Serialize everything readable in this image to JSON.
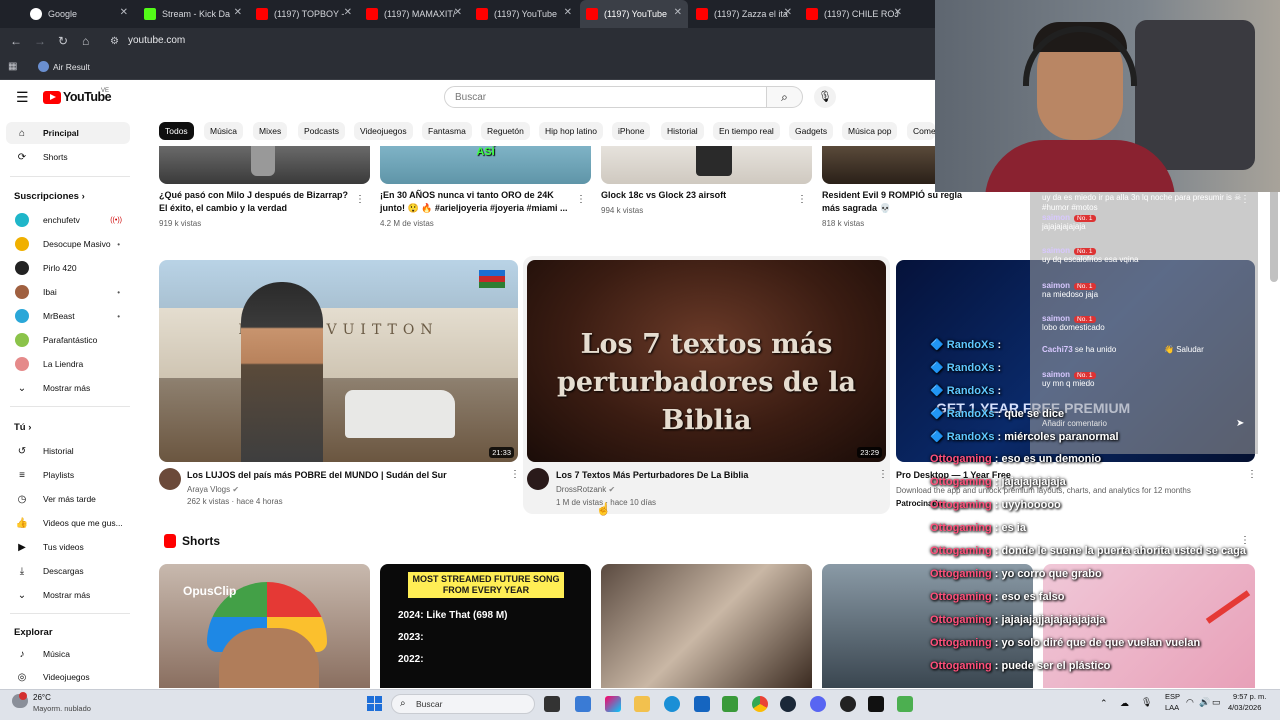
{
  "browser": {
    "tabs": [
      {
        "label": "Google",
        "color": "#4285f4"
      },
      {
        "label": "Stream - Kick Da",
        "color": "#53fc18"
      },
      {
        "label": "(1197) TOPBOY -",
        "color": "#ff0000"
      },
      {
        "label": "(1197) MAMAXIT/",
        "color": "#ff0000"
      },
      {
        "label": "(1197) YouTube",
        "color": "#ff0000"
      },
      {
        "label": "(1197) YouTube",
        "color": "#ff0000"
      },
      {
        "label": "(1197) Zazza el ita",
        "color": "#ff0000"
      },
      {
        "label": "(1197) CHILE ROJ",
        "color": "#ff0000"
      }
    ],
    "url": "youtube.com",
    "bookmark": "Air Result"
  },
  "youtube": {
    "logo": "YouTube",
    "region": "VE",
    "search_placeholder": "Buscar",
    "chips": [
      "Todos",
      "Música",
      "Mixes",
      "Podcasts",
      "Videojuegos",
      "Fantasma",
      "Reguetón",
      "Hip hop latino",
      "iPhone",
      "Historial",
      "En tiempo real",
      "Gadgets",
      "Música pop",
      "Come"
    ],
    "sidebar": {
      "main": [
        {
          "label": "Principal",
          "icon": "home-icon"
        },
        {
          "label": "Shorts",
          "icon": "shorts-icon"
        }
      ],
      "subs_title": "Suscripciones",
      "subs": [
        {
          "label": "enchufetv",
          "color": "#1fb6c9",
          "live": "((•))"
        },
        {
          "label": "Desocupe Masivo",
          "color": "#f0b000",
          "live": "•"
        },
        {
          "label": "Pirlo 420",
          "color": "#222222",
          "live": ""
        },
        {
          "label": "Ibai",
          "color": "#a06040",
          "live": "•"
        },
        {
          "label": "MrBeast",
          "color": "#2aa7d8",
          "live": "•"
        },
        {
          "label": "Parafantástico",
          "color": "#8bc34a",
          "live": ""
        },
        {
          "label": "La Liendra",
          "color": "#e58a8a",
          "live": ""
        }
      ],
      "subs_more": "Mostrar más",
      "you_title": "Tú",
      "you": [
        {
          "label": "Historial",
          "icon": "history-icon"
        },
        {
          "label": "Playlists",
          "icon": "playlist-icon"
        },
        {
          "label": "Ver más tarde",
          "icon": "clock-icon"
        },
        {
          "label": "Videos que me gus...",
          "icon": "thumbs-up-icon"
        },
        {
          "label": "Tus videos",
          "icon": "video-icon"
        },
        {
          "label": "Descargas",
          "icon": "download-icon"
        },
        {
          "label": "Mostrar más",
          "icon": "chevron-down-icon"
        }
      ],
      "explore_title": "Explorar",
      "explore": [
        {
          "label": "Música",
          "icon": "music-icon"
        },
        {
          "label": "Videojuegos",
          "icon": "gamepad-icon"
        }
      ]
    },
    "top_row": [
      {
        "title": "¿Qué pasó con Milo J después de Bizarrap? El éxito, el cambio y la verdad",
        "meta": "919 k vistas"
      },
      {
        "title": "¡En 30 AÑOS nunca vi tanto ORO de 24K junto! 😲 🔥 #arieljoyeria #joyeria #miami ...",
        "meta": "4.2 M de vistas",
        "thumb_text": "ASÍ"
      },
      {
        "title": "Glock 18c vs Glock 23 airsoft",
        "meta": "994 k vistas"
      },
      {
        "title": "Resident Evil 9 ROMPIÓ su regla más sagrada 💀",
        "meta": "818 k vistas"
      }
    ],
    "mid_row": [
      {
        "title": "Los LUJOS del país más POBRE del MUNDO | Sudán del Sur",
        "channel": "Araya Vlogs",
        "meta": "262 k vistas · hace 4 horas",
        "duration": "21:33",
        "thumb_text": "LOUIS VUITTON"
      },
      {
        "title": "Los 7 Textos Más Perturbadores De La Biblia",
        "channel": "DrossRotzank",
        "meta": "1 M de vistas · hace 10 días",
        "duration": "23:29",
        "thumb_text": "Los 7 textos más perturbadores de la Biblia"
      },
      {
        "title": "Pro Desktop — 1 Year Free",
        "channel": "Patrocinado",
        "meta": "Download the app and unlock premium layouts, charts, and analytics for 12 months",
        "ad_text": "GET 1 YEAR FREE PREMIUM"
      }
    ],
    "shorts_title": "Shorts",
    "shorts": [
      {
        "label": "OpusClip"
      },
      {
        "label": "MOST STREAMED FUTURE SONG FROM EVERY YEAR",
        "lines": [
          "2024: Like That (698 M)",
          "2023:",
          "2022:"
        ]
      },
      {
        "label": ""
      },
      {
        "label": ""
      },
      {
        "label": ""
      }
    ]
  },
  "chat": {
    "messages": [
      {
        "user": "",
        "text": "uy da es miedo ir pa alla 3n lq noche para presumir is ☠ #humor #motos"
      },
      {
        "user": "saimon",
        "badge": "No. 1",
        "text": "jajajajajajaja"
      },
      {
        "user": "saimon",
        "badge": "No. 1",
        "text": "uy dq escalofrios esa vqina"
      },
      {
        "user": "saimon",
        "badge": "No. 1",
        "text": "na miedoso jaja"
      },
      {
        "user": "saimon",
        "badge": "No. 1",
        "text": "lobo domesticado"
      },
      {
        "user": "Cachi73",
        "badge": "",
        "text": "se ha unido"
      },
      {
        "user": "saimon",
        "badge": "No. 1",
        "text": "uy mn q miedo"
      }
    ],
    "greet": "Saludar",
    "comment_placeholder": "Añadir comentario"
  },
  "overlay": [
    {
      "user": "RandoXs",
      "text": "que se dice",
      "kind": "rand"
    },
    {
      "user": "RandoXs",
      "text": "miércoles paranormal",
      "kind": "rand"
    },
    {
      "user": "Ottogaming",
      "text": "eso es un demonio",
      "kind": "otto"
    },
    {
      "user": "Ottogaming",
      "text": "jajajajajajaja",
      "kind": "otto"
    },
    {
      "user": "Ottogaming",
      "text": "uyyhooooo",
      "kind": "otto"
    },
    {
      "user": "Ottogaming",
      "text": "es ia",
      "kind": "otto"
    },
    {
      "user": "Ottogaming",
      "text": "donde le suene la puerta ahorita usted se caga",
      "kind": "otto"
    },
    {
      "user": "Ottogaming",
      "text": "yo corro que grabo",
      "kind": "otto"
    },
    {
      "user": "Ottogaming",
      "text": "eso es falso",
      "kind": "otto"
    },
    {
      "user": "Ottogaming",
      "text": "jajajajajjajajajajajaja",
      "kind": "otto"
    },
    {
      "user": "Ottogaming",
      "text": "yo solo diré que de que vuelan vuelan",
      "kind": "otto"
    },
    {
      "user": "Ottogaming",
      "text": "puede ser el plástico",
      "kind": "otto"
    }
  ],
  "overlay_rand_prefix": [
    {
      "user": "RandoXs",
      "text": ""
    },
    {
      "user": "RandoXs",
      "text": ""
    },
    {
      "user": "RandoXs",
      "text": ""
    }
  ],
  "taskbar": {
    "weather_temp": "26°C",
    "weather_desc": "Mayorm. nublado",
    "search": "Buscar",
    "lang": "ESP",
    "lang2": "LAA",
    "time": "9:57 p. m.",
    "date": "4/03/2026"
  }
}
